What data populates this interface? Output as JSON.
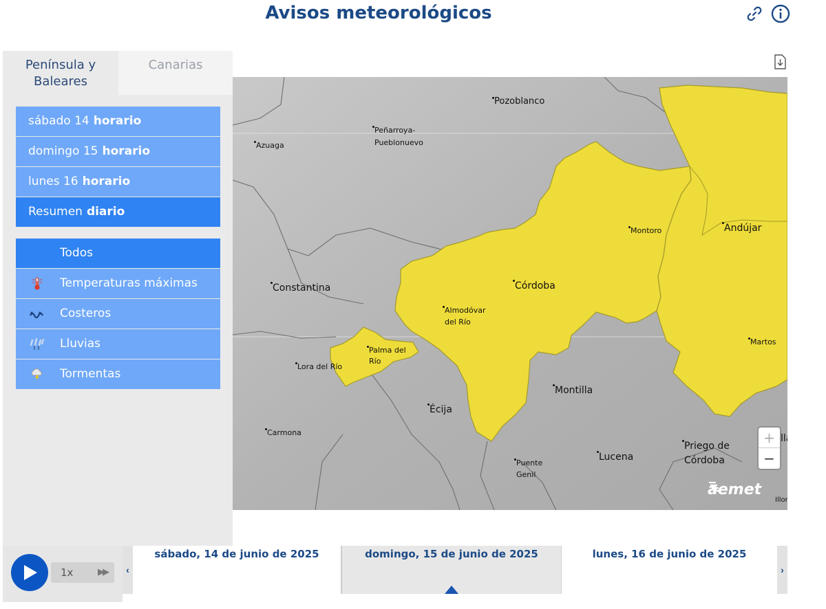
{
  "header": {
    "title": "Avisos meteorológicos",
    "link_icon": "link-icon",
    "info_icon": "info-icon"
  },
  "region_tabs": [
    {
      "label_line1": "Península y",
      "label_line2": "Baleares",
      "active": true
    },
    {
      "label_line1": "Canarias",
      "label_line2": "",
      "active": false
    }
  ],
  "day_buttons": [
    {
      "day": "sábado 14",
      "mode": "horario",
      "active": false
    },
    {
      "day": "domingo 15",
      "mode": "horario",
      "active": false
    },
    {
      "day": "lunes 16",
      "mode": "horario",
      "active": false
    },
    {
      "day": "Resumen",
      "mode": "diario",
      "active": true
    }
  ],
  "type_buttons": [
    {
      "label": "Todos",
      "icon": "",
      "active": true
    },
    {
      "label": "Temperaturas máximas",
      "icon": "thermometer-icon",
      "active": false
    },
    {
      "label": "Costeros",
      "icon": "waves-icon",
      "active": false
    },
    {
      "label": "Lluvias",
      "icon": "rain-icon",
      "active": false
    },
    {
      "label": "Tormentas",
      "icon": "storm-icon",
      "active": false
    }
  ],
  "map": {
    "warning_color": "#eedc3a",
    "cities": [
      "Pozoblanco",
      "Peñarroya-",
      "Pueblonuevo",
      "Azuaga",
      "Montoro",
      "Andújar",
      "Constantina",
      "Córdoba",
      "Almodóvar",
      "del Río",
      "Martos",
      "Palma del",
      "Río",
      "Lora del Río",
      "Montilla",
      "Écija",
      "Carmona",
      "Priego de",
      "Córdoba",
      "Lucena",
      "Puente",
      "Genil",
      "llá",
      "Illor"
    ],
    "zoom_in": "+",
    "zoom_out": "−",
    "logo": "aemet"
  },
  "player": {
    "speed": "1x",
    "fast_forward": "▶▶"
  },
  "timeline": {
    "days": [
      {
        "label": "sábado, 14 de junio de 2025",
        "selected": false
      },
      {
        "label": "domingo, 15 de junio de 2025",
        "selected": true
      },
      {
        "label": "lunes, 16 de junio de 2025",
        "selected": false
      }
    ],
    "prev": "‹",
    "next": "›"
  }
}
